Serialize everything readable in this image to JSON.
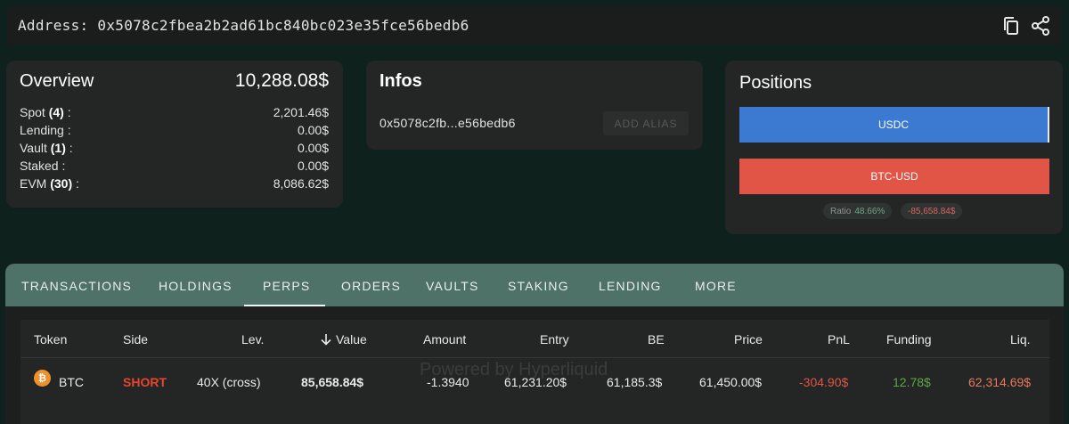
{
  "address_bar": {
    "label": "Address: 0x5078c2fbea2b2ad61bc840bc023e35fce56bedb6",
    "copy_icon": "copy-icon",
    "share_icon": "share-icon"
  },
  "overview": {
    "title": "Overview",
    "total": "10,288.08$",
    "rows": [
      {
        "label": "Spot",
        "count": "(4)",
        "suffix": " :",
        "value": "2,201.46$"
      },
      {
        "label": "Lending",
        "count": "",
        "suffix": " :",
        "value": "0.00$"
      },
      {
        "label": "Vault",
        "count": "(1)",
        "suffix": " :",
        "value": "0.00$"
      },
      {
        "label": "Staked",
        "count": "",
        "suffix": " :",
        "value": "0.00$"
      },
      {
        "label": "EVM",
        "count": "(30)",
        "suffix": " :",
        "value": "8,086.62$"
      }
    ]
  },
  "infos": {
    "title": "Infos",
    "short_address": "0x5078c2fb...e56bedb6",
    "add_alias_label": "ADD ALIAS"
  },
  "positions": {
    "title": "Positions",
    "bars": [
      {
        "label": "USDC",
        "color": "#3c79d0"
      },
      {
        "label": "BTC-USD",
        "color": "#e05546"
      }
    ],
    "ratio_label": "Ratio",
    "ratio_value": "48.66%",
    "pnl_value": "-85,658.84$"
  },
  "tabs": {
    "items": [
      "TRANSACTIONS",
      "HOLDINGS",
      "PERPS",
      "ORDERS",
      "VAULTS",
      "STAKING",
      "LENDING",
      "MORE"
    ],
    "active": "PERPS"
  },
  "table": {
    "headers": {
      "token": "Token",
      "side": "Side",
      "lev": "Lev.",
      "value": "Value",
      "amount": "Amount",
      "entry": "Entry",
      "be": "BE",
      "price": "Price",
      "pnl": "PnL",
      "funding": "Funding",
      "liq": "Liq."
    },
    "sort_icon": "arrow-down-icon",
    "watermark": "Powered by Hyperliquid",
    "rows": [
      {
        "token": "BTC",
        "token_icon": "bitcoin-icon",
        "side": "SHORT",
        "lev": "40X (cross)",
        "value": "85,658.84$",
        "amount": "-1.3940",
        "entry": "61,231.20$",
        "be": "61,185.3$",
        "price": "61,450.00$",
        "pnl": "-304.90$",
        "funding": "12.78$",
        "liq": "62,314.69$"
      }
    ]
  },
  "colors": {
    "short": "#e8452f",
    "negative": "#e05546",
    "positive": "#62a544",
    "liq": "#e8795c"
  }
}
